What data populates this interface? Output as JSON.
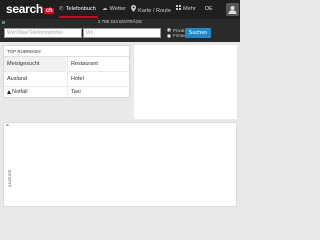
{
  "header": {
    "logo": "search",
    "logo_badge": "ch",
    "nav": [
      {
        "label": "Telefonbuch",
        "icon": "phone-icon",
        "active": true
      },
      {
        "label": "Wetter",
        "icon": "cloud-icon",
        "active": false
      },
      {
        "label": "Karte / Route",
        "icon": "map-pin-icon",
        "active": false
      },
      {
        "label": "Mehr",
        "icon": "grid-icon",
        "active": false
      }
    ],
    "language": "DE",
    "accent_color": "#e2001a"
  },
  "search": {
    "entries_count": "2 788 244 EINTRÄGE",
    "what_placeholder": "Wer/Was/Telefonnummer",
    "where_placeholder": "Wo",
    "radio_options": [
      {
        "label": "Privat",
        "checked": true
      },
      {
        "label": "Firmen",
        "checked": false
      }
    ],
    "button_label": "Suchen",
    "button_color": "#1e88c9"
  },
  "rubriken": {
    "title": "TOP RUBRIKEN",
    "left": [
      {
        "label": "Meistgesucht",
        "selected": true
      },
      {
        "label": "Ausland",
        "selected": false
      },
      {
        "label": "Notfall",
        "selected": false,
        "icon": "warning-icon"
      }
    ],
    "right": [
      "Restaurant",
      "Hotel",
      "Taxi"
    ]
  },
  "ad": {
    "close": "×",
    "label": "ANZEIGE"
  }
}
